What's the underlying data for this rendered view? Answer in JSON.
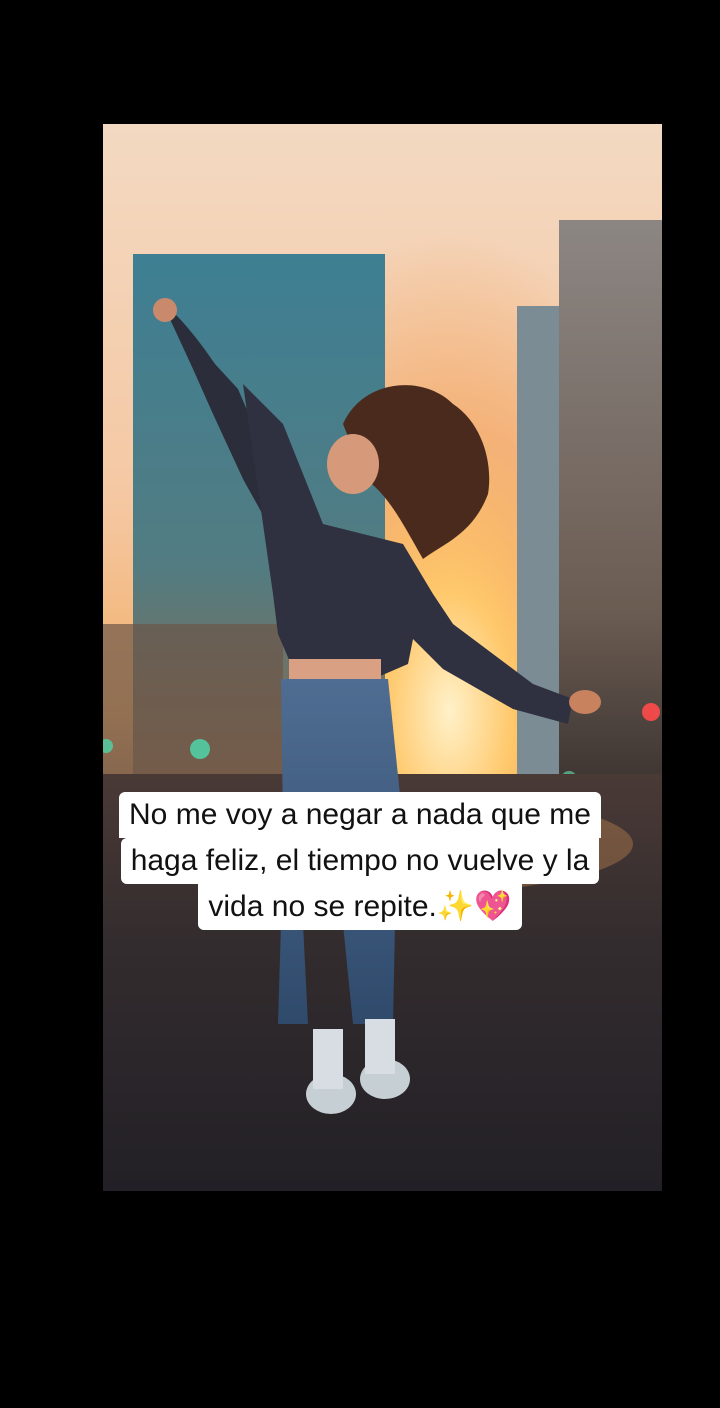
{
  "caption": {
    "line1": "No me voy a negar a nada que me",
    "line2": "haga feliz, el tiempo no vuelve y la",
    "line3": "vida no se repite.",
    "emoji1": "✨",
    "emoji2": "💖"
  },
  "colors": {
    "background": "#000000",
    "caption_bg": "#ffffff",
    "caption_text": "#111111",
    "sky_warm": "#f5c8a3",
    "sun": "#ffb347"
  }
}
